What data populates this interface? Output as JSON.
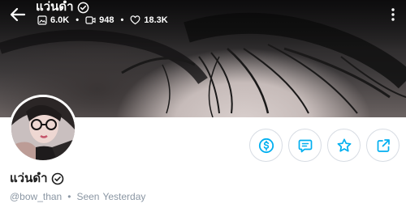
{
  "header": {
    "title": "แว่นดำ",
    "stats": [
      {
        "icon": "image-icon",
        "value": "6.0K"
      },
      {
        "icon": "video-icon",
        "value": "948"
      },
      {
        "icon": "heart-icon",
        "value": "18.3K"
      }
    ],
    "stat_separator": "•"
  },
  "profile": {
    "name": "แว่นดำ",
    "handle": "@bow_than",
    "separator": "•",
    "seen_label": "Seen",
    "seen_value": "Yesterday"
  },
  "actions": [
    {
      "icon": "dollar-icon"
    },
    {
      "icon": "message-icon"
    },
    {
      "icon": "star-icon"
    },
    {
      "icon": "share-icon"
    }
  ],
  "colors": {
    "accent": "#00aff0",
    "text_primary": "#1b1b1b",
    "text_muted": "#8a96a3",
    "button_border": "#d7dce3"
  }
}
